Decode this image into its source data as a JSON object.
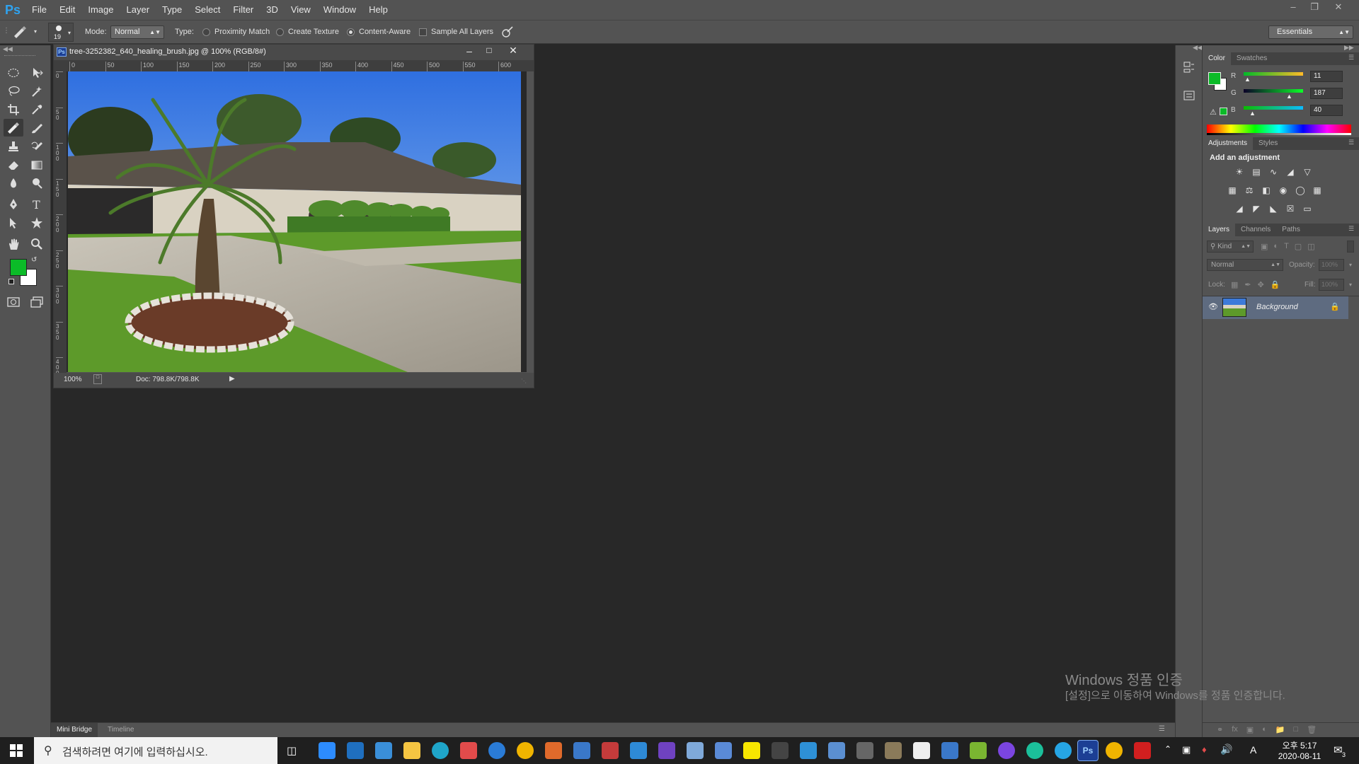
{
  "app": {
    "logo": "Ps"
  },
  "menu": [
    "File",
    "Edit",
    "Image",
    "Layer",
    "Type",
    "Select",
    "Filter",
    "3D",
    "View",
    "Window",
    "Help"
  ],
  "options_bar": {
    "brush_size": "19",
    "mode_label": "Mode:",
    "mode_value": "Normal",
    "type_label": "Type:",
    "type_options": [
      "Proximity Match",
      "Create Texture",
      "Content-Aware"
    ],
    "type_selected": "Content-Aware",
    "sample_all_layers": "Sample All Layers",
    "workspace": "Essentials"
  },
  "document": {
    "title": "tree-3252382_640_healing_brush.jpg @ 100% (RGB/8#)",
    "zoom": "100%",
    "doc_info": "Doc: 798.8K/798.8K",
    "ruler_h": [
      "0",
      "50",
      "100",
      "150",
      "200",
      "250",
      "300",
      "350",
      "400",
      "450",
      "500",
      "550",
      "600"
    ],
    "ruler_v": [
      "0",
      "5\n0",
      "1\n0\n0",
      "1\n5\n0",
      "2\n0\n0",
      "2\n5\n0",
      "3\n0\n0",
      "3\n5\n0",
      "4\n0\n0"
    ]
  },
  "color_panel": {
    "tabs": [
      "Color",
      "Swatches"
    ],
    "channels": [
      {
        "name": "R",
        "value": "11"
      },
      {
        "name": "G",
        "value": "187"
      },
      {
        "name": "B",
        "value": "40"
      }
    ],
    "foreground": "#0bbb28",
    "background": "#ffffff"
  },
  "adjustments_panel": {
    "tabs": [
      "Adjustments",
      "Styles"
    ],
    "heading": "Add an adjustment"
  },
  "layers_panel": {
    "tabs": [
      "Layers",
      "Channels",
      "Paths"
    ],
    "filter": "Kind",
    "blend_mode": "Normal",
    "opacity_label": "Opacity:",
    "opacity_value": "100%",
    "lock_label": "Lock:",
    "fill_label": "Fill:",
    "fill_value": "100%",
    "layers": [
      {
        "name": "Background",
        "visible": true,
        "locked": true
      }
    ]
  },
  "bottom_tabs": [
    "Mini Bridge",
    "Timeline"
  ],
  "taskbar": {
    "search_placeholder": "검색하려면 여기에 입력하십시오.",
    "time": "오후 5:17",
    "date": "2020-08-11",
    "notifications": "3",
    "ime": "A"
  },
  "watermark": {
    "line1": "Windows 정품 인증",
    "line2": "[설정]으로 이동하여 Windows를 정품 인증합니다."
  }
}
